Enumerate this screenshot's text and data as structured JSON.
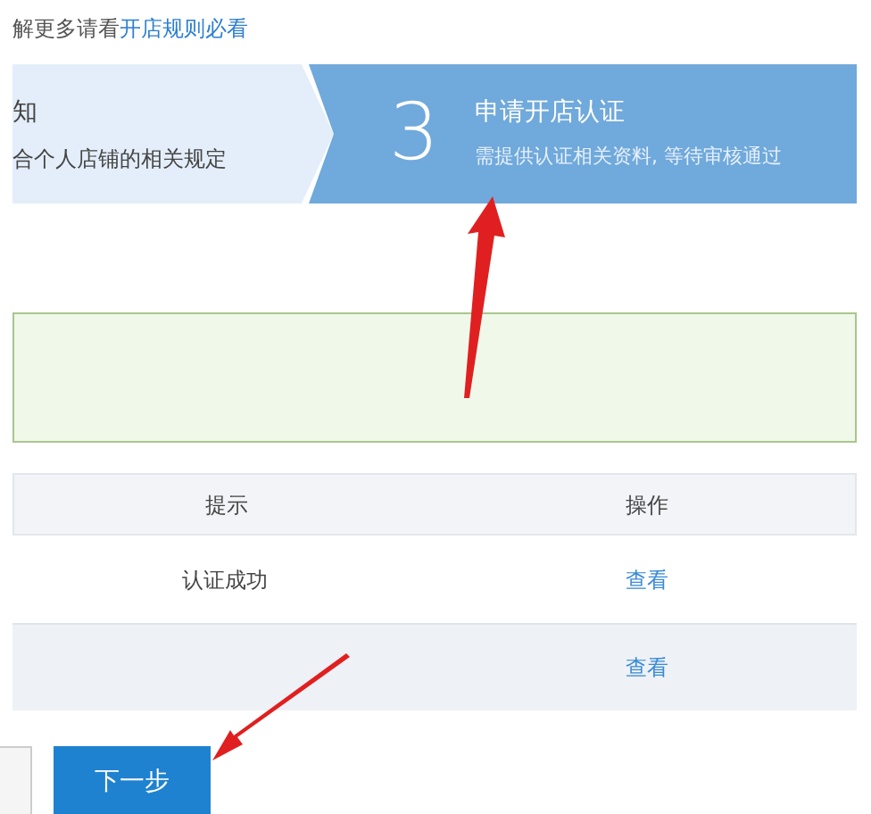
{
  "notice": {
    "text": "解更多请看",
    "link": "开店规则必看"
  },
  "steps": [
    {
      "title": "知",
      "subtitle": "合个人店铺的相关规定",
      "selected": false
    },
    {
      "number": "3",
      "title": "申请开店认证",
      "subtitle": "需提供认证相关资料, 等待审核通过",
      "selected": true
    }
  ],
  "table": {
    "columns": [
      "提示",
      "操作"
    ],
    "rows": [
      {
        "cells": [
          "认证成功",
          "查看"
        ]
      },
      {
        "cells": [
          null,
          "查看"
        ]
      }
    ]
  },
  "buttons": [
    {
      "kind": "secondary"
    },
    {
      "label": "下一步",
      "kind": "primary"
    }
  ]
}
